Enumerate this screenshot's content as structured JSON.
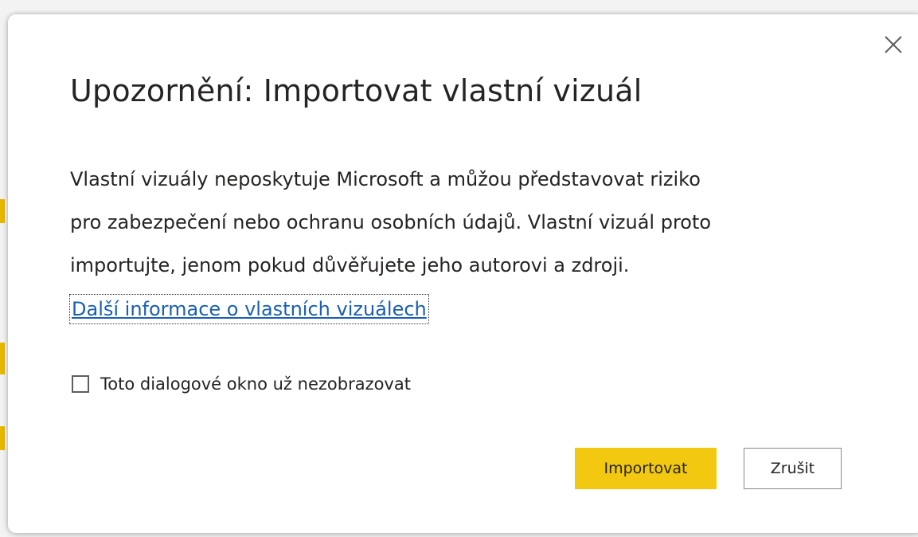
{
  "dialog": {
    "title": "Upozornění: Importovat vlastní vizuál",
    "body_lines": [
      "Vlastní vizuály neposkytuje Microsoft a můžou představovat riziko",
      "pro zabezpečení nebo ochranu osobních údajů. Vlastní vizuál proto",
      "importujte, jenom pokud důvěřujete jeho autorovi a zdroji."
    ],
    "learn_more_link": "Další informace o vlastních vizuálech",
    "dont_show_checkbox": {
      "label": "Toto dialogové okno už nezobrazovat",
      "checked": false
    },
    "import_button": "Importovat",
    "cancel_button": "Zrušit",
    "close_icon": "close-icon"
  },
  "colors": {
    "primary_button": "#f2c811",
    "link": "#1a5fb4",
    "text": "#252423"
  }
}
